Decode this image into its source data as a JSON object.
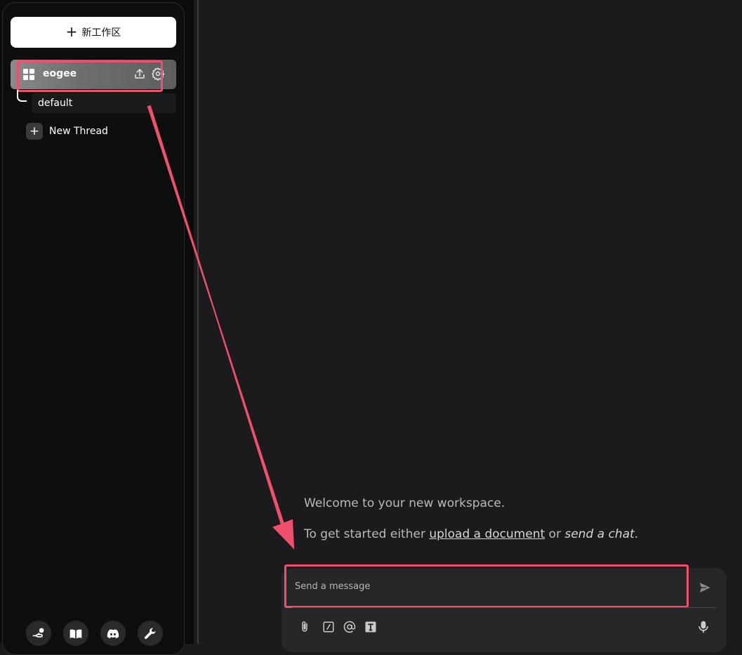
{
  "sidebar": {
    "new_workspace_label": "新工作区",
    "workspace": {
      "name": "eogee",
      "icon": "grid-icon"
    },
    "threads": [
      {
        "label": "default"
      }
    ],
    "new_thread_label": "New Thread",
    "footer_icons": [
      "community-hub-icon",
      "docs-book-icon",
      "discord-icon",
      "settings-wrench-icon"
    ]
  },
  "main": {
    "welcome_line": "Welcome to your new workspace.",
    "start_prefix": "To get started either",
    "upload_link": "upload a document",
    "or_text": "or",
    "send_chat": "send a chat",
    "period": "."
  },
  "composer": {
    "placeholder": "Send a message",
    "tools": [
      "attach-icon",
      "slash-command-icon",
      "at-mention-icon",
      "text-size-icon",
      "microphone-icon"
    ]
  },
  "colors": {
    "highlight": "#f0506b",
    "background": "#1b1b1d",
    "sidebar": "#0d0e0e"
  }
}
